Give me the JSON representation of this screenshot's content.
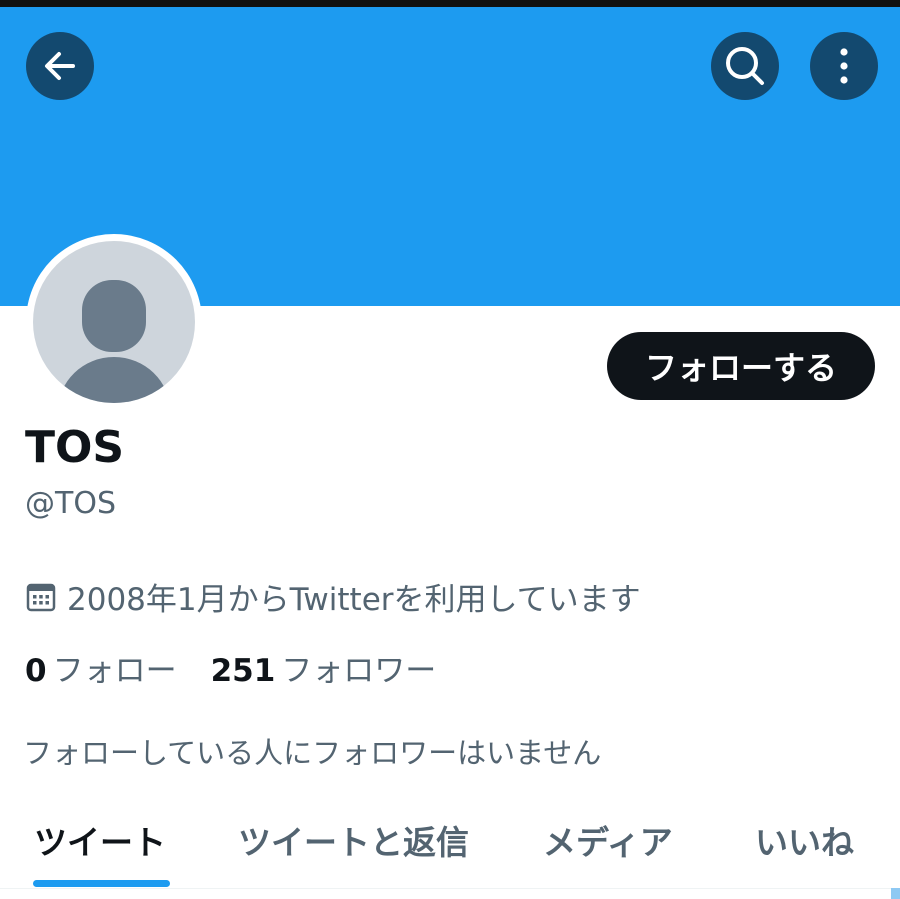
{
  "colors": {
    "banner": "#1d9bf0",
    "header_button_bg": "#13496f",
    "follow_button_bg": "#0f1419",
    "secondary_text": "#536471",
    "tab_indicator": "#1d9bf0",
    "avatar_bg": "#ced5dc",
    "avatar_figure": "#6a7b8b"
  },
  "header": {
    "back_icon": "arrow-left-icon",
    "search_icon": "search-icon",
    "more_icon": "more-vertical-icon"
  },
  "profile": {
    "display_name": "TOS",
    "handle": "@TOS",
    "follow_button_label": "フォローする",
    "joined_icon": "calendar-icon",
    "joined_text": "2008年1月からTwitterを利用しています",
    "following_count": "0",
    "following_label": "フォロー",
    "followers_count": "251",
    "followers_label": "フォロワー",
    "known_followers_text": "フォローしている人にフォロワーはいません"
  },
  "tabs": [
    {
      "label": "ツイート",
      "active": true
    },
    {
      "label": "ツイートと返信",
      "active": false
    },
    {
      "label": "メディア",
      "active": false
    },
    {
      "label": "いいね",
      "active": false
    }
  ]
}
